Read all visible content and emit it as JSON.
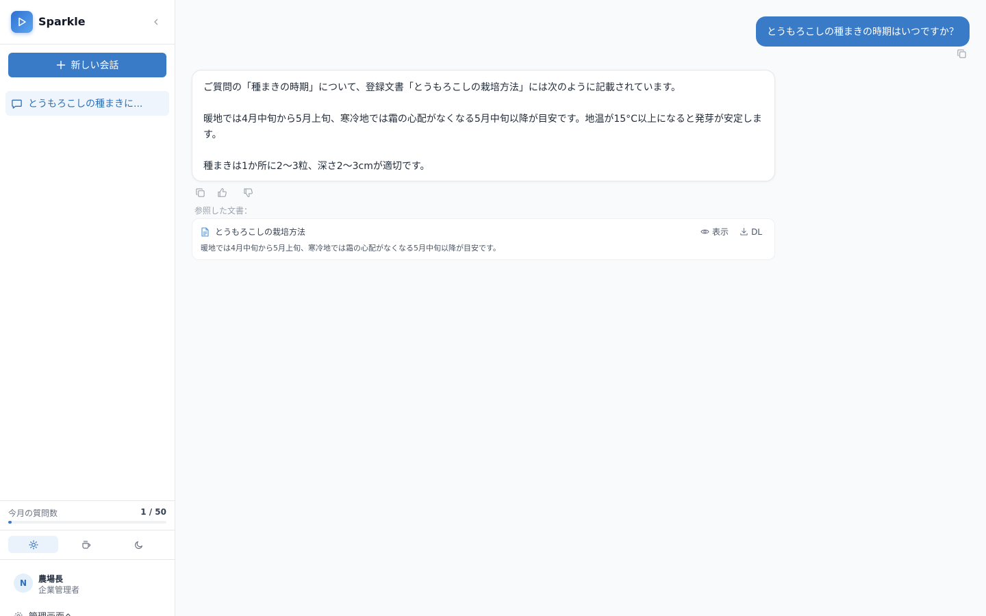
{
  "app": {
    "name": "Sparkle"
  },
  "sidebar": {
    "new_chat_label": "新しい会話",
    "conversations": [
      {
        "title": "とうもろこしの種まきに..."
      }
    ],
    "usage": {
      "label": "今月の質問数",
      "count_text": "1 / 50",
      "used": 1,
      "limit": 50
    },
    "themes": [
      {
        "icon": "sun-icon",
        "active": true
      },
      {
        "icon": "coffee-icon",
        "active": false
      },
      {
        "icon": "moon-icon",
        "active": false
      }
    ],
    "user": {
      "initial": "N",
      "name": "農場長",
      "role": "企業管理者"
    },
    "admin_link": "管理画面へ"
  },
  "chat": {
    "user_message": "とうもろこしの種まきの時期はいつですか？",
    "assistant_message": {
      "para1": "ご質問の「種まきの時期」について、登録文書「とうもろこしの栽培方法」には次のように記載されています。",
      "para2": "暖地では4月中旬から5月上旬、寒冷地では霜の心配がなくなる5月中旬以降が目安です。地温が15°C以上になると発芽が安定します。",
      "para3": "種まきは1か所に2〜3粒、深さ2〜3cmが適切です。"
    },
    "references_label": "参照した文書：",
    "references": [
      {
        "title": "とうもろこしの栽培方法",
        "snippet": "暖地では4月中旬から5月上旬、寒冷地では霜の心配がなくなる5月中旬以降が目安です。",
        "view_label": "表示",
        "download_label": "DL"
      }
    ]
  },
  "colors": {
    "accent": "#3a7bc8",
    "accent_light": "#eef5fc"
  }
}
